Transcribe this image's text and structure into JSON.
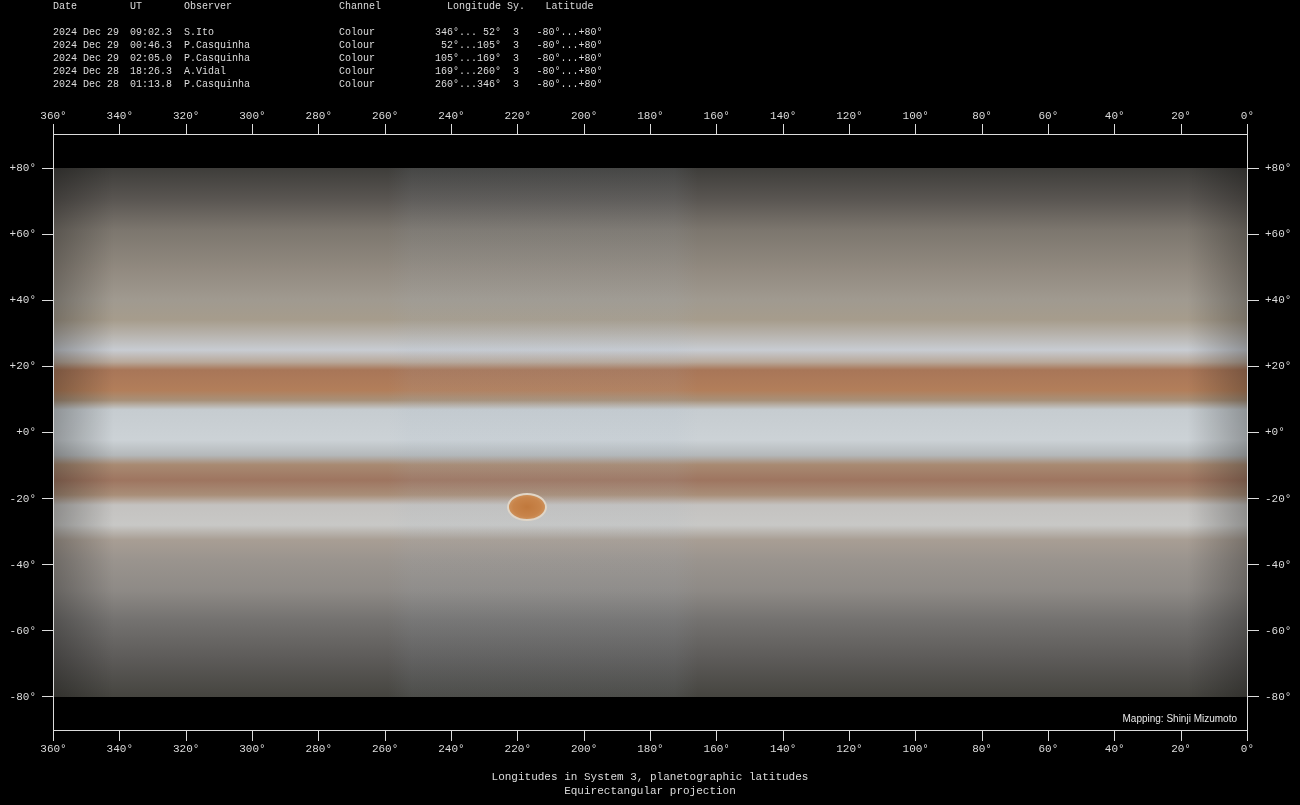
{
  "observations": {
    "columns": [
      "Date",
      "UT",
      "Observer",
      "Channel",
      "Longitude",
      "Sy.",
      "Latitude"
    ],
    "rows": [
      [
        "2024 Dec 29",
        "09:02.3",
        "S.Ito",
        "Colour",
        "346°... 52°",
        "3",
        "-80°...+80°"
      ],
      [
        "2024 Dec 29",
        "00:46.3",
        "P.Casquinha",
        "Colour",
        "52°...105°",
        "3",
        "-80°...+80°"
      ],
      [
        "2024 Dec 29",
        "02:05.0",
        "P.Casquinha",
        "Colour",
        "105°...169°",
        "3",
        "-80°...+80°"
      ],
      [
        "2024 Dec 28",
        "18:26.3",
        "A.Vidal",
        "Colour",
        "169°...260°",
        "3",
        "-80°...+80°"
      ],
      [
        "2024 Dec 28",
        "01:13.8",
        "P.Casquinha",
        "Colour",
        "260°...346°",
        "3",
        "-80°...+80°"
      ]
    ]
  },
  "map": {
    "top_axis": {
      "labels": [
        "360°",
        "340°",
        "320°",
        "300°",
        "280°",
        "260°",
        "240°",
        "220°",
        "200°",
        "180°",
        "160°",
        "140°",
        "120°",
        "100°",
        "80°",
        "60°",
        "40°",
        "20°",
        "0°"
      ]
    },
    "left_axis": {
      "labels": [
        "+80°",
        "+60°",
        "+40°",
        "+20°",
        "+0°",
        "-20°",
        "-40°",
        "-60°",
        "-80°"
      ]
    },
    "right_axis": {
      "labels": [
        "+80°",
        "+60°",
        "+40°",
        "+20°",
        "+0°",
        "-20°",
        "-40°",
        "-60°",
        "-80°"
      ]
    },
    "credit": "Mapping: Shinji Mizumoto",
    "bottom_axis": {
      "labels": [
        "360°",
        "340°",
        "320°",
        "300°",
        "280°",
        "260°",
        "240°",
        "220°",
        "200°",
        "180°",
        "160°",
        "140°",
        "120°",
        "100°",
        "80°",
        "60°",
        "40°",
        "20°",
        "0°"
      ]
    }
  },
  "caption": [
    "Longitudes in System 3, planetographic latitudes",
    "Equirectangular projection"
  ]
}
